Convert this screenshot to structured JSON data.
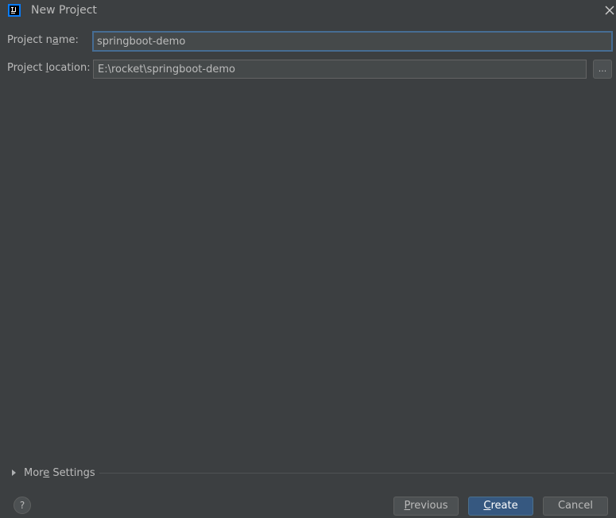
{
  "window": {
    "title": "New Project",
    "app_icon": "intellij-idea-icon",
    "close_icon": "close-icon"
  },
  "form": {
    "project_name": {
      "label_pre": "Project n",
      "label_mnemonic": "a",
      "label_post": "me:",
      "value": "springboot-demo"
    },
    "project_location": {
      "label_pre": "Project ",
      "label_mnemonic": "l",
      "label_post": "ocation:",
      "value": "E:\\rocket\\springboot-demo",
      "browse_label": "..."
    }
  },
  "more_settings": {
    "label_pre": "Mor",
    "label_mnemonic": "e",
    "label_post": " Settings",
    "icon": "triangle-right-icon"
  },
  "footer": {
    "help_label": "?",
    "previous": {
      "mnemonic": "P",
      "rest": "revious"
    },
    "create": {
      "mnemonic": "C",
      "rest": "reate"
    },
    "cancel_label": "Cancel"
  },
  "colors": {
    "background": "#3c3f41",
    "text": "#bbbbbb",
    "input_bg": "#45494a",
    "focus_border": "#466d94",
    "default_button": "#365880"
  }
}
